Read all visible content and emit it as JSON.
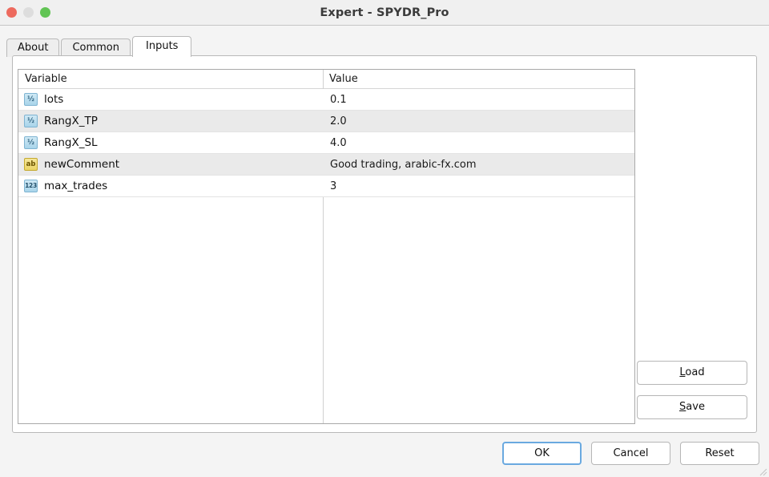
{
  "window": {
    "title": "Expert - SPYDR_Pro",
    "traffic_lights": [
      {
        "name": "close",
        "color": "#ed6a5e"
      },
      {
        "name": "minimize",
        "color": "#dddddd"
      },
      {
        "name": "maximize",
        "color": "#61c454"
      }
    ]
  },
  "tabs": [
    {
      "label": "About",
      "active": false
    },
    {
      "label": "Common",
      "active": false
    },
    {
      "label": "Inputs",
      "active": true
    }
  ],
  "inputs_table": {
    "columns": [
      "Variable",
      "Value"
    ],
    "rows": [
      {
        "icon": "half-icon",
        "icon_glyph": "½",
        "variable": "lots",
        "value": "0.1"
      },
      {
        "icon": "half-icon",
        "icon_glyph": "½",
        "variable": "RangX_TP",
        "value": "2.0"
      },
      {
        "icon": "half-icon",
        "icon_glyph": "½",
        "variable": "RangX_SL",
        "value": "4.0"
      },
      {
        "icon": "string-icon",
        "icon_glyph": "ab",
        "variable": "newComment",
        "value": "Good trading, arabic-fx.com"
      },
      {
        "icon": "integer-icon",
        "icon_glyph": "123",
        "variable": "max_trades",
        "value": "3"
      }
    ]
  },
  "side_buttons": {
    "load": {
      "mnemonic": "L",
      "rest": "oad"
    },
    "save": {
      "mnemonic": "S",
      "rest": "ave"
    }
  },
  "footer_buttons": [
    {
      "label": "OK",
      "default": true
    },
    {
      "label": "Cancel",
      "default": false
    },
    {
      "label": "Reset",
      "default": false
    }
  ],
  "colors": {
    "accent_focus": "#6aa9e0",
    "row_alt": "#eaeaea",
    "panel_border": "#b9b9b9"
  }
}
